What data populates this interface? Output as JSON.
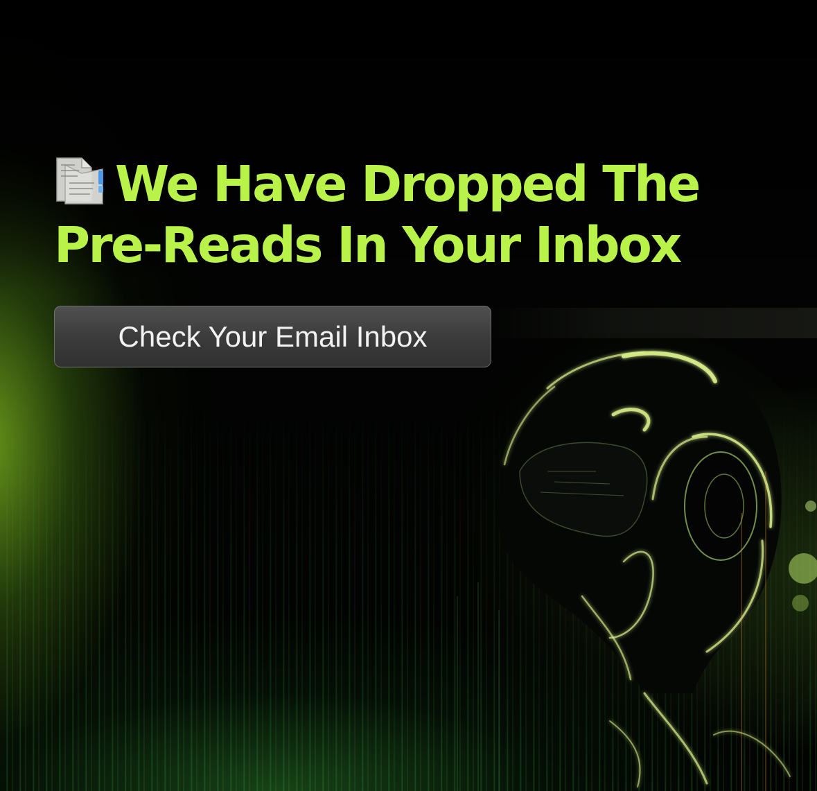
{
  "hero": {
    "title": "We Have Dropped The Pre-Reads In Your Inbox",
    "title_icon": "page-facing-up-icon",
    "cta_label": "Check Your Email Inbox"
  },
  "colors": {
    "accent": "#b9f34a",
    "background": "#020302",
    "button": "#3a3a3a",
    "button_text": "#f2f2f2"
  },
  "illustration": "robot-head"
}
